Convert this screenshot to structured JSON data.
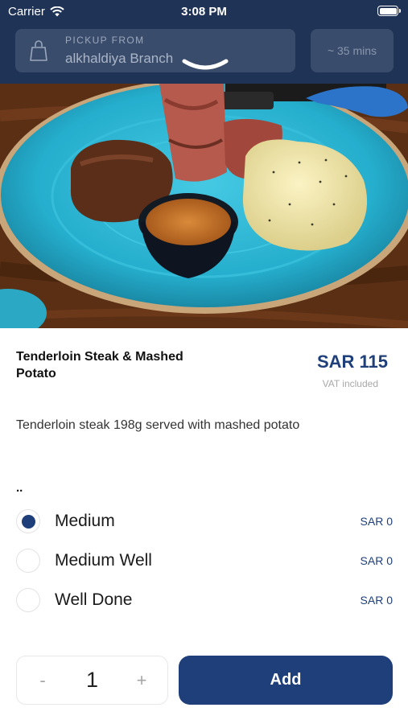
{
  "status_bar": {
    "carrier": "Carrier",
    "time": "3:08 PM"
  },
  "header": {
    "pickup_caption": "PICKUP FROM",
    "branch": "alkhaldiya Branch",
    "eta": "~ 35 mins",
    "icons": [
      "wifi-icon",
      "battery-icon",
      "bag-icon",
      "chevron-down-icon"
    ]
  },
  "product": {
    "name": "Tenderloin Steak & Mashed Potato",
    "price": "SAR 115",
    "vat_note": "VAT included",
    "description": "Tenderloin steak 198g served with mashed potato",
    "image": "steak-plate-photo"
  },
  "options": {
    "title": "..",
    "items": [
      {
        "label": "Medium",
        "price": "SAR 0",
        "selected": true
      },
      {
        "label": "Medium Well",
        "price": "SAR 0",
        "selected": false
      },
      {
        "label": "Well Done",
        "price": "SAR 0",
        "selected": false
      }
    ]
  },
  "cart": {
    "minus": "-",
    "quantity": "1",
    "plus": "+",
    "add_label": "Add"
  },
  "colors": {
    "header": "#1f3356",
    "accent": "#1f3f7a",
    "plate": "#2ab6d4"
  }
}
